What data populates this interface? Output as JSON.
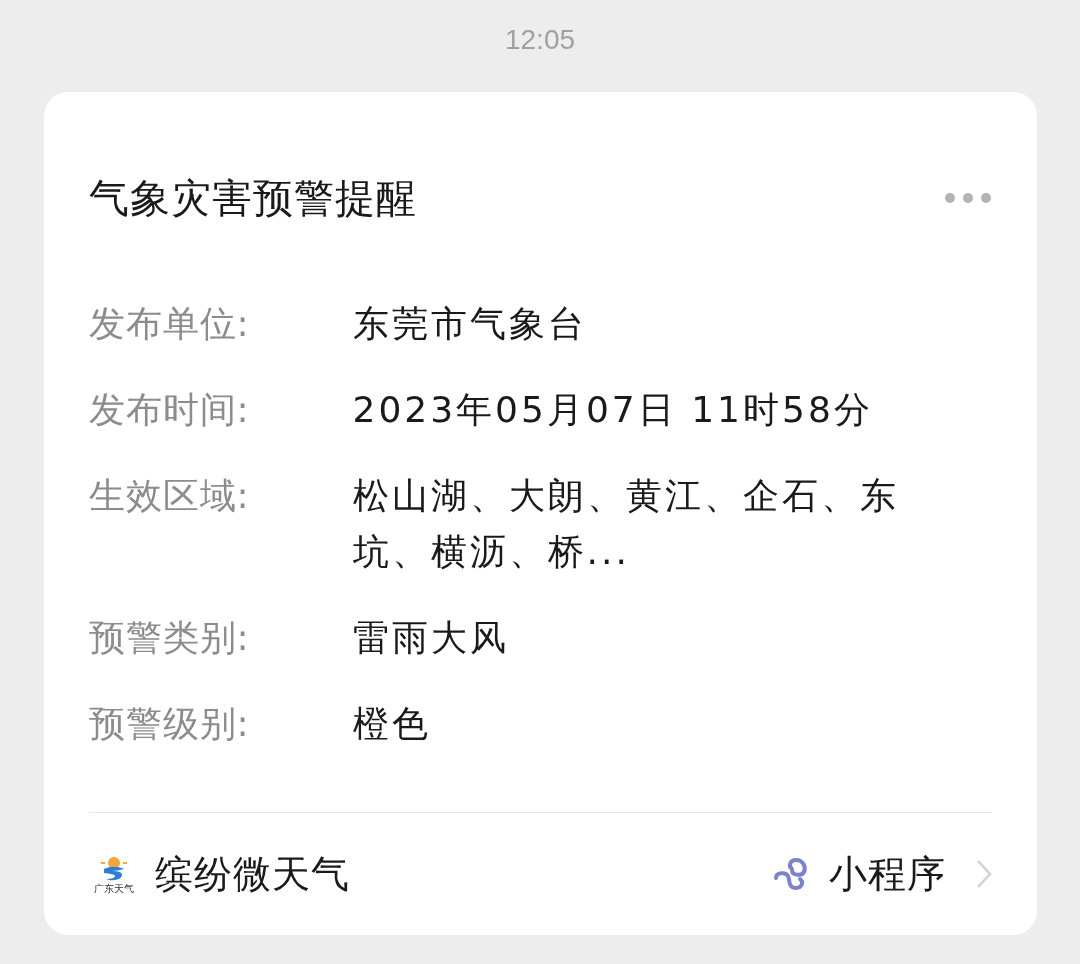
{
  "time": "12:05",
  "card": {
    "title": "气象灾害预警提醒",
    "fields": [
      {
        "label": "发布单位:",
        "value": "东莞市气象台"
      },
      {
        "label": "发布时间:",
        "value": "2023年05月07日 11时58分"
      },
      {
        "label": "生效区域:",
        "value": "松山湖、大朗、黄江、企石、东坑、横沥、桥..."
      },
      {
        "label": "预警类别:",
        "value": "雷雨大风"
      },
      {
        "label": "预警级别:",
        "value": "橙色"
      }
    ],
    "source": {
      "logo_text": "广东天气",
      "name": "缤纷微天气"
    },
    "tag": "小程序"
  }
}
